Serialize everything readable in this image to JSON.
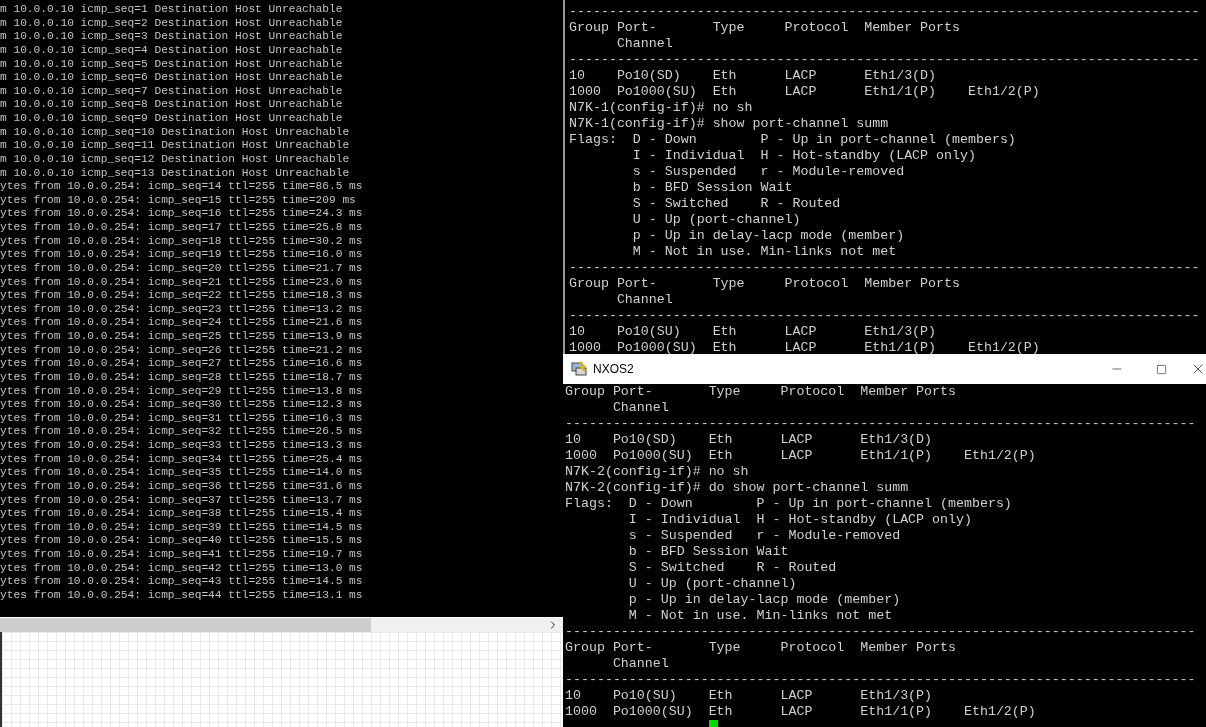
{
  "ping_terminal": {
    "lines": [
      "m 10.0.0.10 icmp_seq=1 Destination Host Unreachable",
      "m 10.0.0.10 icmp_seq=2 Destination Host Unreachable",
      "m 10.0.0.10 icmp_seq=3 Destination Host Unreachable",
      "m 10.0.0.10 icmp_seq=4 Destination Host Unreachable",
      "m 10.0.0.10 icmp_seq=5 Destination Host Unreachable",
      "m 10.0.0.10 icmp_seq=6 Destination Host Unreachable",
      "m 10.0.0.10 icmp_seq=7 Destination Host Unreachable",
      "m 10.0.0.10 icmp_seq=8 Destination Host Unreachable",
      "m 10.0.0.10 icmp_seq=9 Destination Host Unreachable",
      "m 10.0.0.10 icmp_seq=10 Destination Host Unreachable",
      "m 10.0.0.10 icmp_seq=11 Destination Host Unreachable",
      "m 10.0.0.10 icmp_seq=12 Destination Host Unreachable",
      "m 10.0.0.10 icmp_seq=13 Destination Host Unreachable",
      "ytes from 10.0.0.254: icmp_seq=14 ttl=255 time=86.5 ms",
      "ytes from 10.0.0.254: icmp_seq=15 ttl=255 time=209 ms",
      "ytes from 10.0.0.254: icmp_seq=16 ttl=255 time=24.3 ms",
      "ytes from 10.0.0.254: icmp_seq=17 ttl=255 time=25.8 ms",
      "ytes from 10.0.0.254: icmp_seq=18 ttl=255 time=30.2 ms",
      "ytes from 10.0.0.254: icmp_seq=19 ttl=255 time=16.0 ms",
      "ytes from 10.0.0.254: icmp_seq=20 ttl=255 time=21.7 ms",
      "ytes from 10.0.0.254: icmp_seq=21 ttl=255 time=23.0 ms",
      "ytes from 10.0.0.254: icmp_seq=22 ttl=255 time=18.3 ms",
      "ytes from 10.0.0.254: icmp_seq=23 ttl=255 time=13.2 ms",
      "ytes from 10.0.0.254: icmp_seq=24 ttl=255 time=21.6 ms",
      "ytes from 10.0.0.254: icmp_seq=25 ttl=255 time=13.9 ms",
      "ytes from 10.0.0.254: icmp_seq=26 ttl=255 time=21.2 ms",
      "ytes from 10.0.0.254: icmp_seq=27 ttl=255 time=16.6 ms",
      "ytes from 10.0.0.254: icmp_seq=28 ttl=255 time=18.7 ms",
      "ytes from 10.0.0.254: icmp_seq=29 ttl=255 time=13.8 ms",
      "ytes from 10.0.0.254: icmp_seq=30 ttl=255 time=12.3 ms",
      "ytes from 10.0.0.254: icmp_seq=31 ttl=255 time=16.3 ms",
      "ytes from 10.0.0.254: icmp_seq=32 ttl=255 time=26.5 ms",
      "ytes from 10.0.0.254: icmp_seq=33 ttl=255 time=13.3 ms",
      "ytes from 10.0.0.254: icmp_seq=34 ttl=255 time=25.4 ms",
      "ytes from 10.0.0.254: icmp_seq=35 ttl=255 time=14.0 ms",
      "ytes from 10.0.0.254: icmp_seq=36 ttl=255 time=31.6 ms",
      "ytes from 10.0.0.254: icmp_seq=37 ttl=255 time=13.7 ms",
      "ytes from 10.0.0.254: icmp_seq=38 ttl=255 time=15.4 ms",
      "ytes from 10.0.0.254: icmp_seq=39 ttl=255 time=14.5 ms",
      "ytes from 10.0.0.254: icmp_seq=40 ttl=255 time=15.5 ms",
      "ytes from 10.0.0.254: icmp_seq=41 ttl=255 time=19.7 ms",
      "ytes from 10.0.0.254: icmp_seq=42 ttl=255 time=13.0 ms",
      "ytes from 10.0.0.254: icmp_seq=43 ttl=255 time=14.5 ms",
      "ytes from 10.0.0.254: icmp_seq=44 ttl=255 time=13.1 ms"
    ]
  },
  "switch_console": {
    "lines": [
      "-------------------------------------------------------------------------------",
      "Group Port-       Type     Protocol  Member Ports",
      "      Channel",
      "-------------------------------------------------------------------------------",
      "10    Po10(SD)    Eth      LACP      Eth1/3(D)",
      "1000  Po1000(SU)  Eth      LACP      Eth1/1(P)    Eth1/2(P)",
      "N7K-1(config-if)# no sh",
      "N7K-1(config-if)# show port-channel summ",
      "Flags:  D - Down        P - Up in port-channel (members)",
      "        I - Individual  H - Hot-standby (LACP only)",
      "        s - Suspended   r - Module-removed",
      "        b - BFD Session Wait",
      "        S - Switched    R - Routed",
      "        U - Up (port-channel)",
      "        p - Up in delay-lacp mode (member)",
      "        M - Not in use. Min-links not met",
      "-------------------------------------------------------------------------------",
      "Group Port-       Type     Protocol  Member Ports",
      "      Channel",
      "-------------------------------------------------------------------------------",
      "10    Po10(SU)    Eth      LACP      Eth1/3(P)",
      "1000  Po1000(SU)  Eth      LACP      Eth1/1(P)    Eth1/2(P)"
    ]
  },
  "nxos2_window": {
    "title": "NXOS2",
    "lines": [
      "Group Port-       Type     Protocol  Member Ports",
      "      Channel",
      "-------------------------------------------------------------------------------",
      "10    Po10(SD)    Eth      LACP      Eth1/3(D)",
      "1000  Po1000(SU)  Eth      LACP      Eth1/1(P)    Eth1/2(P)",
      "N7K-2(config-if)# no sh",
      "N7K-2(config-if)# do show port-channel summ",
      "Flags:  D - Down        P - Up in port-channel (members)",
      "        I - Individual  H - Hot-standby (LACP only)",
      "        s - Suspended   r - Module-removed",
      "        b - BFD Session Wait",
      "        S - Switched    R - Routed",
      "        U - Up (port-channel)",
      "        p - Up in delay-lacp mode (member)",
      "        M - Not in use. Min-links not met",
      "-------------------------------------------------------------------------------",
      "Group Port-       Type     Protocol  Member Ports",
      "      Channel",
      "-------------------------------------------------------------------------------",
      "10    Po10(SU)    Eth      LACP      Eth1/3(P)",
      "1000  Po1000(SU)  Eth      LACP      Eth1/1(P)    Eth1/2(P)"
    ]
  }
}
